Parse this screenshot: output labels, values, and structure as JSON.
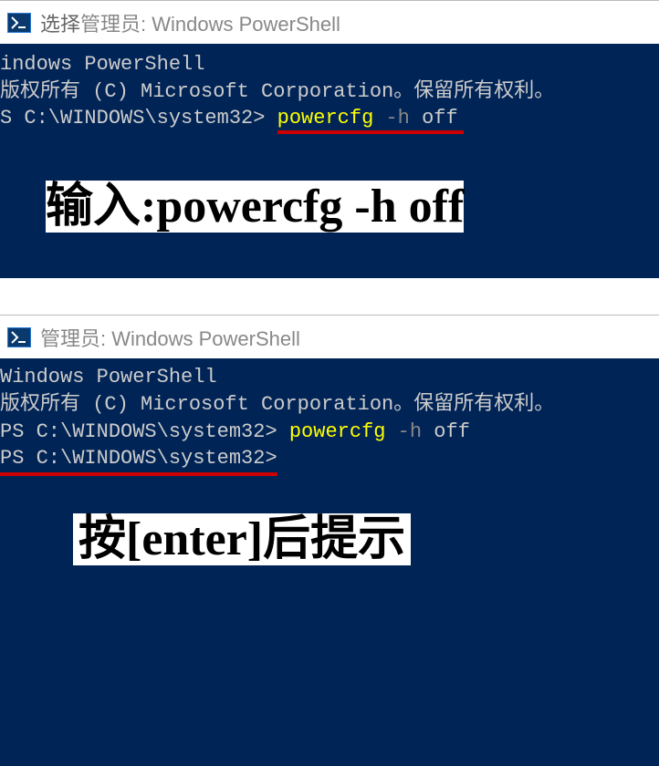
{
  "window1": {
    "title_prefix": "选择",
    "title_main": "管理员: Windows PowerShell",
    "line1": "indows PowerShell",
    "line2": "版权所有 (C) Microsoft Corporation。保留所有权利。",
    "blank": "",
    "prompt": "S C:\\WINDOWS\\system32> ",
    "cmd": "powercfg",
    "flag": " -h ",
    "arg": "off"
  },
  "annotation1": {
    "label": "输入:",
    "cmd": "powercfg -h off"
  },
  "window2": {
    "title_main": "管理员: Windows PowerShell",
    "line1": "Windows PowerShell",
    "line2": "版权所有 (C) Microsoft Corporation。保留所有权利。",
    "blank": "",
    "prompt1": "PS C:\\WINDOWS\\system32> ",
    "cmd": "powercfg",
    "flag": " -h ",
    "arg": "off",
    "prompt2": "PS C:\\WINDOWS\\system32>",
    "cursor": " "
  },
  "annotation2": {
    "text": "按[enter]后提示"
  }
}
